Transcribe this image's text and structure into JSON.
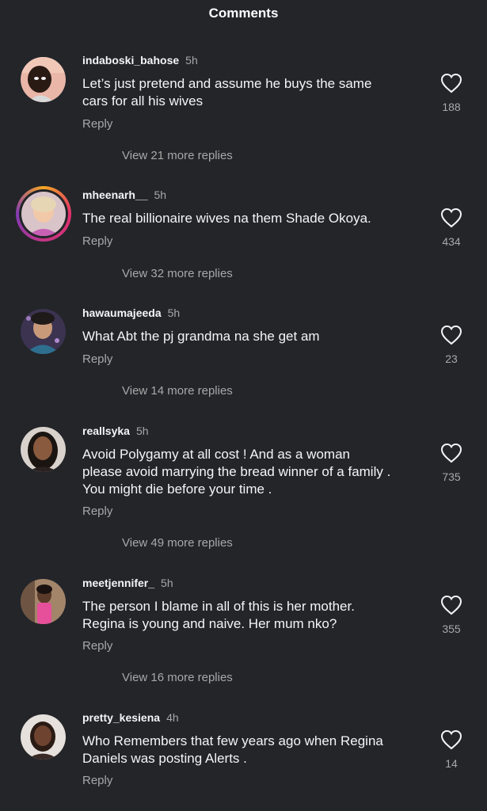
{
  "header": {
    "title": "Comments"
  },
  "labels": {
    "reply": "Reply"
  },
  "colors": {
    "background": "#232529",
    "text_primary": "#f3f5f7",
    "text_secondary": "#a8a8a8"
  },
  "comments": [
    {
      "username": "indaboski_bahose",
      "time": "5h",
      "lines": [
        "Let’s just pretend and assume he buys the same",
        "cars for all his wives"
      ],
      "likes": "188",
      "view_replies": "View 21 more replies"
    },
    {
      "username": "mheenarh__",
      "time": "5h",
      "lines": [
        "The real billionaire wives na them Shade Okoya."
      ],
      "likes": "434",
      "view_replies": "View 32 more replies"
    },
    {
      "username": "hawaumajeeda",
      "time": "5h",
      "lines": [
        "What Abt the pj grandma na she get am"
      ],
      "likes": "23",
      "view_replies": "View 14 more replies"
    },
    {
      "username": "reallsyka",
      "time": "5h",
      "lines": [
        "Avoid Polygamy at all cost !  And as a woman",
        "please avoid marrying the bread winner of a family .",
        "You might die before your time ."
      ],
      "likes": "735",
      "view_replies": "View 49 more replies"
    },
    {
      "username": "meetjennifer_",
      "time": "5h",
      "lines": [
        "The person I blame in all of this is her mother.",
        "Regina is young and naive. Her mum nko?"
      ],
      "likes": "355",
      "view_replies": "View 16 more replies"
    },
    {
      "username": "pretty_kesiena",
      "time": "4h",
      "lines": [
        "Who Remembers that few years ago when Regina",
        "Daniels was posting Alerts ."
      ],
      "likes": "14"
    }
  ]
}
